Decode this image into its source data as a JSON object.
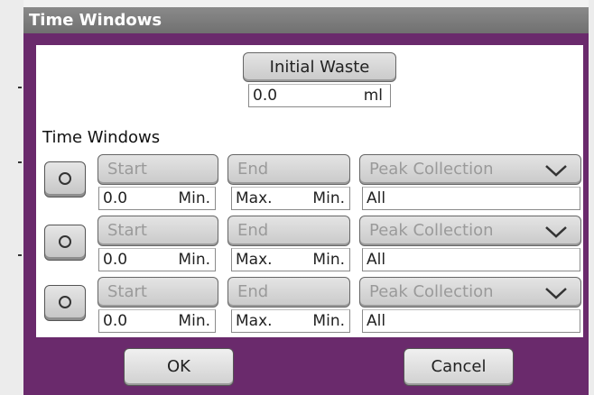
{
  "window": {
    "title": "Time Windows"
  },
  "initial_waste": {
    "button_label": "Initial Waste",
    "value": "0.0",
    "unit": "ml"
  },
  "section_label": "Time Windows",
  "rows": [
    {
      "start_label": "Start",
      "end_label": "End",
      "collection_label": "Peak Collection",
      "start_value": "0.0",
      "start_unit": "Min.",
      "end_value": "Max.",
      "end_unit": "Min.",
      "collection_value": "All"
    },
    {
      "start_label": "Start",
      "end_label": "End",
      "collection_label": "Peak Collection",
      "start_value": "0.0",
      "start_unit": "Min.",
      "end_value": "Max.",
      "end_unit": "Min.",
      "collection_value": "All"
    },
    {
      "start_label": "Start",
      "end_label": "End",
      "collection_label": "Peak Collection",
      "start_value": "0.0",
      "start_unit": "Min.",
      "end_value": "Max.",
      "end_unit": "Min.",
      "collection_value": "All"
    }
  ],
  "footer": {
    "ok_label": "OK",
    "cancel_label": "Cancel"
  },
  "colors": {
    "frame": "#6a2a6c",
    "title_bar": "#7d7d7d"
  },
  "icons": {
    "row_toggle": "radio-circle-icon",
    "dropdown": "chevron-down-icon"
  }
}
